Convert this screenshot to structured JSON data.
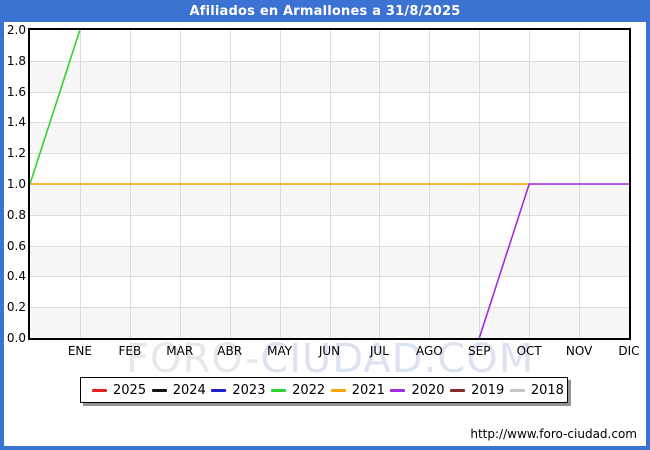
{
  "header": {
    "title": "Afiliados en Armallones a 31/8/2025"
  },
  "watermark": {
    "part1": "FORO-",
    "part2": "CIUDAD.COM"
  },
  "footer": {
    "url": "http://www.foro-ciudad.com"
  },
  "colors": {
    "frame_blue": "#3c72d2",
    "grid": "#dcdcdc",
    "band_alt": "#f7f7f7",
    "plot_border": "#000000",
    "watermark_gray": "#e8e8e8",
    "watermark_blue": "#dde2f3"
  },
  "chart_data": {
    "type": "line",
    "title": "Afiliados en Armallones a 31/8/2025",
    "x_categories": [
      "ENE",
      "FEB",
      "MAR",
      "ABR",
      "MAY",
      "JUN",
      "JUL",
      "AGO",
      "SEP",
      "OCT",
      "NOV",
      "DIC"
    ],
    "x_unit": "month_index (0 = left axis edge, 1 = ENE ... 12 = DIC)",
    "y_ticks": [
      "2.0",
      "1.8",
      "1.6",
      "1.4",
      "1.2",
      "1.0",
      "0.8",
      "0.6",
      "0.4",
      "0.2",
      "0.0"
    ],
    "ylim": [
      0.0,
      2.0
    ],
    "xlim": [
      0,
      12
    ],
    "grid": true,
    "band_striping": "alternating 0.2-unit horizontal bands, white and light gray",
    "legend_position": "bottom",
    "series": [
      {
        "name": "2025",
        "color": "#e01f1f",
        "points": []
      },
      {
        "name": "2024",
        "color": "#151515",
        "points": []
      },
      {
        "name": "2023",
        "color": "#1f1fd0",
        "points": []
      },
      {
        "name": "2022",
        "color": "#2ed52e",
        "points": [
          [
            0,
            1.0
          ],
          [
            1,
            2.0
          ]
        ]
      },
      {
        "name": "2021",
        "color": "#ffa408",
        "points": [
          [
            0,
            1.0
          ],
          [
            10,
            1.0
          ]
        ]
      },
      {
        "name": "2020",
        "color": "#a02ce2",
        "points": [
          [
            9,
            0.0
          ],
          [
            10,
            1.0
          ],
          [
            12,
            1.0
          ]
        ]
      },
      {
        "name": "2019",
        "color": "#8b2828",
        "points": []
      },
      {
        "name": "2018",
        "color": "#c6c6c6",
        "points": []
      }
    ]
  }
}
